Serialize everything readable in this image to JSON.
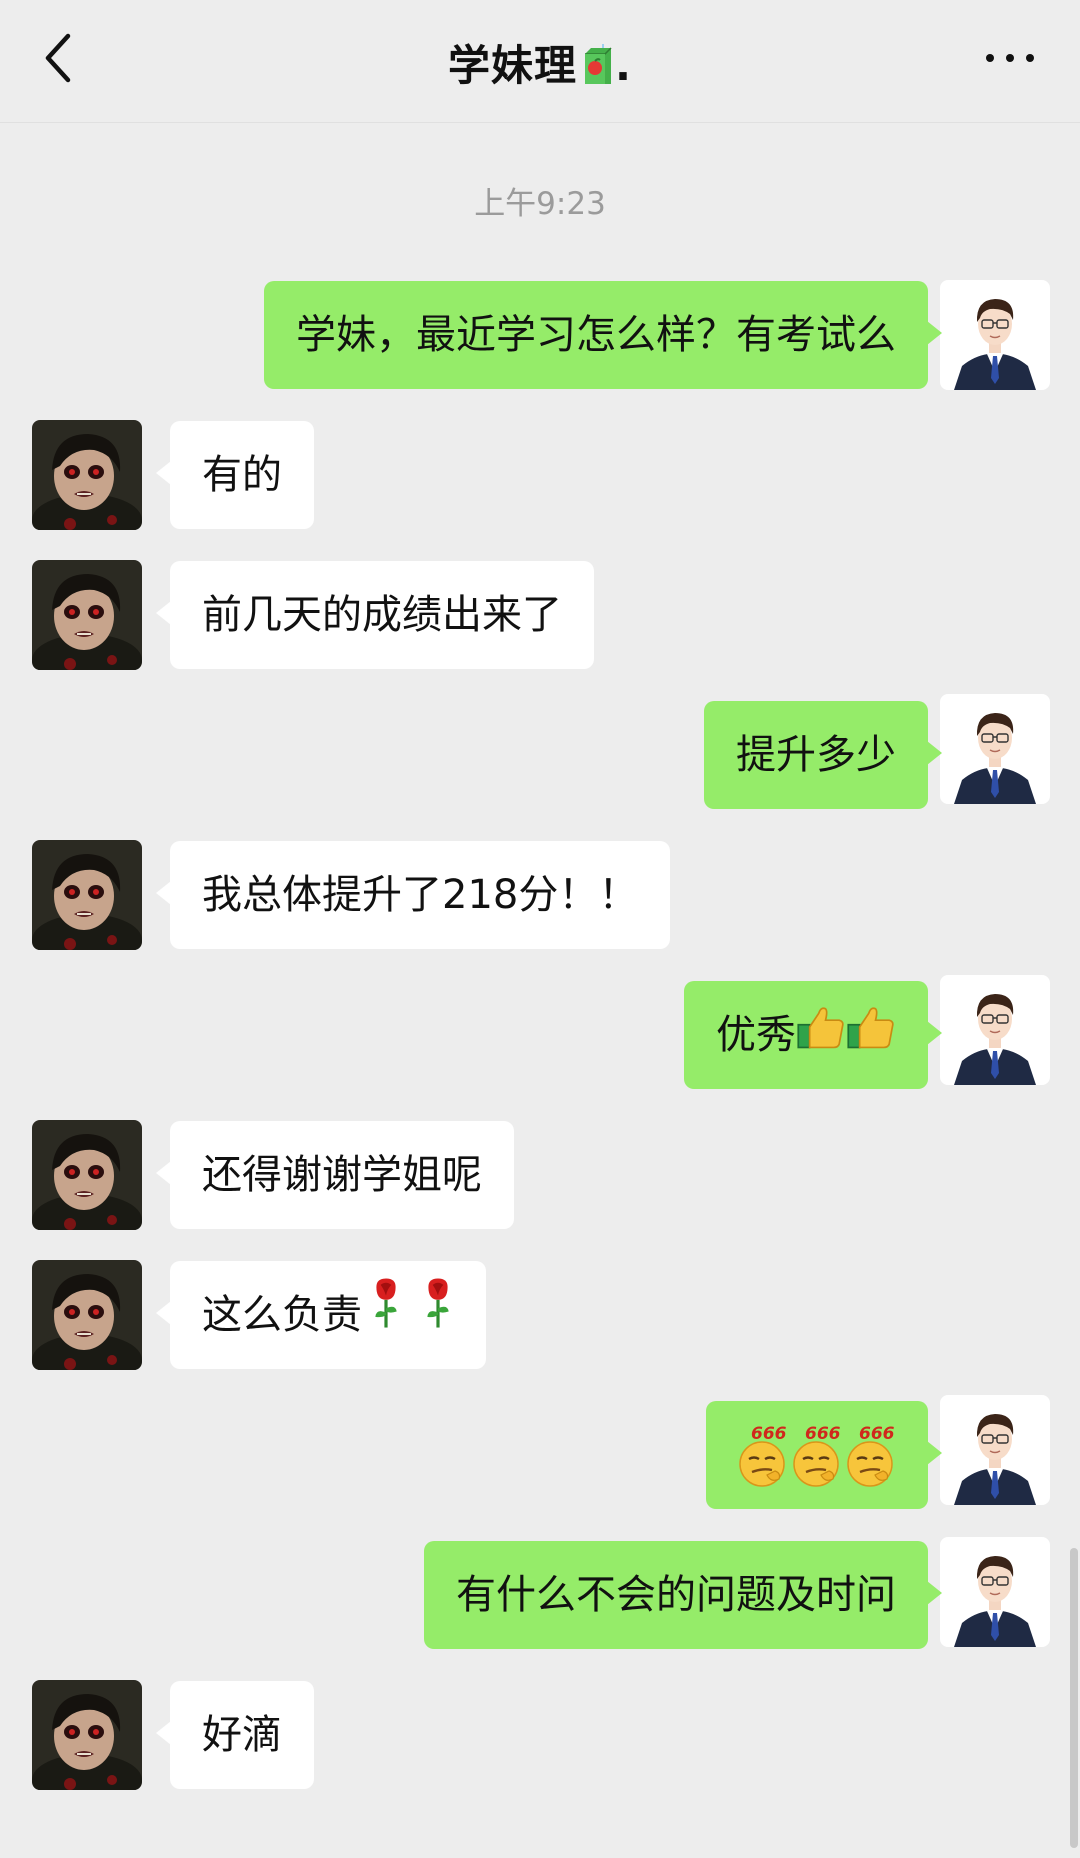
{
  "header": {
    "title": "学妹理",
    "title_suffix": ".",
    "back_icon": "chevron-left-icon",
    "more_icon": "ellipsis-icon"
  },
  "timestamp": "上午9:23",
  "messages": [
    {
      "side": "out",
      "text": "学妹，最近学习怎么样？有考试么"
    },
    {
      "side": "in",
      "text": "有的"
    },
    {
      "side": "in",
      "text": "前几天的成绩出来了"
    },
    {
      "side": "out",
      "text": "提升多少"
    },
    {
      "side": "in",
      "text": "我总体提升了218分！！"
    },
    {
      "side": "out",
      "text": "优秀",
      "emoji": [
        "thumbs-up-icon",
        "thumbs-up-icon"
      ]
    },
    {
      "side": "in",
      "text": "还得谢谢学姐呢"
    },
    {
      "side": "in",
      "text": "这么负责",
      "emoji": [
        "rose-icon",
        "rose-icon"
      ]
    },
    {
      "side": "out",
      "text": "",
      "emoji_label": "666",
      "emoji": [
        "emoji-666-icon",
        "emoji-666-icon",
        "emoji-666-icon"
      ]
    },
    {
      "side": "out",
      "text": "有什么不会的问题及时问"
    },
    {
      "side": "in",
      "text": "好滴"
    }
  ],
  "colors": {
    "background": "#ededed",
    "outgoing_bubble": "#95ec69",
    "incoming_bubble": "#ffffff",
    "timestamp": "#9b9b9b"
  }
}
